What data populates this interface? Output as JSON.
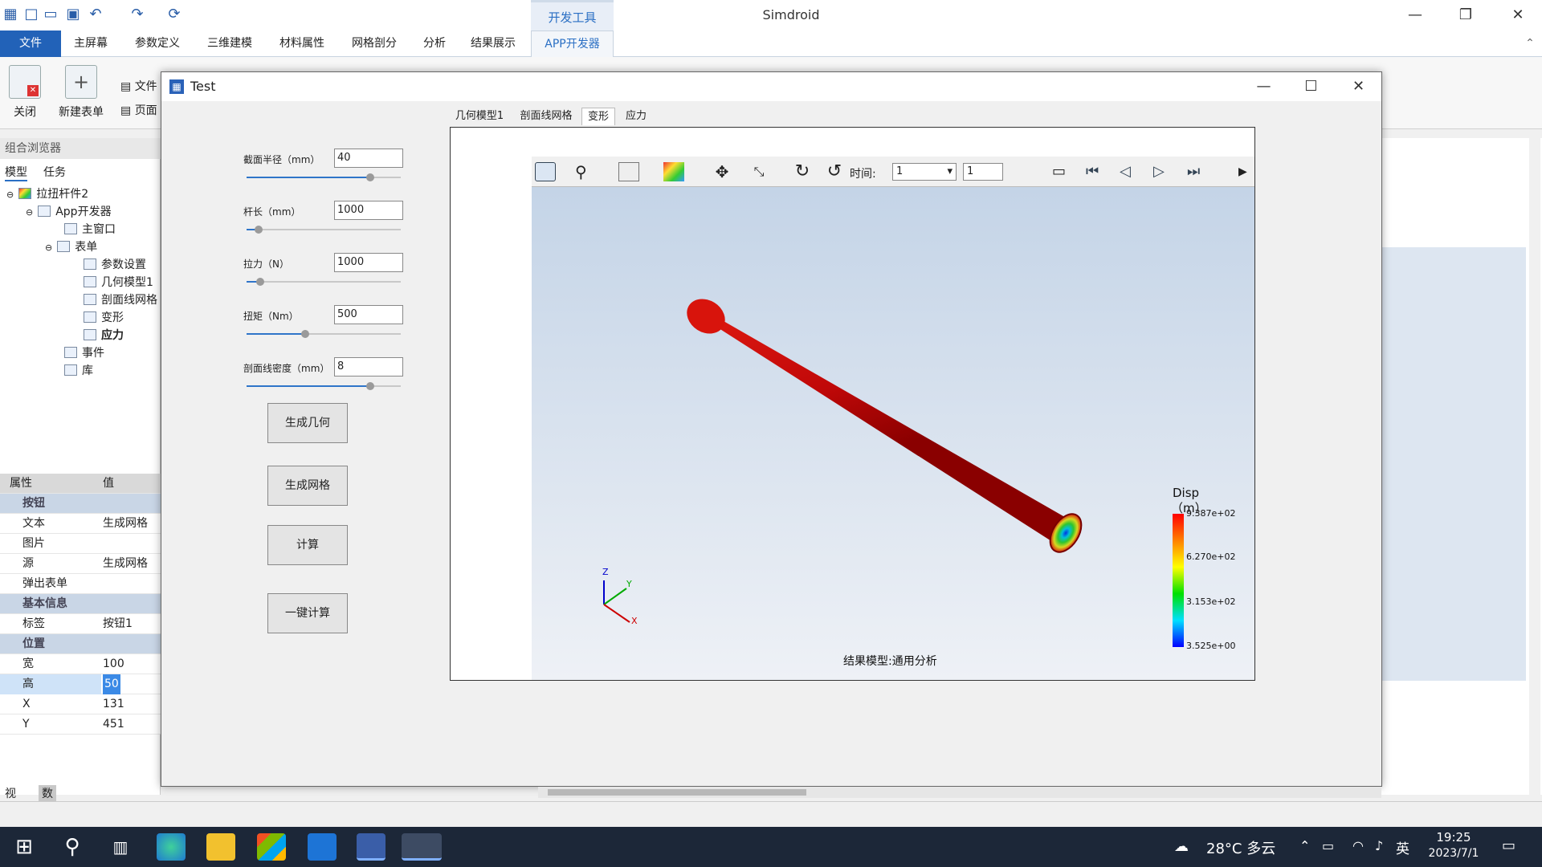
{
  "app_title": "Simdroid",
  "dev_group": "开发工具",
  "ribbon_tabs": [
    "文件",
    "主屏幕",
    "参数定义",
    "三维建模",
    "材料属性",
    "网格剖分",
    "分析",
    "结果展示",
    "APP开发器"
  ],
  "ribbon_buttons": {
    "close": "关闭",
    "new_form": "新建表单",
    "file_trunc": "文件",
    "page_trunc": "页面"
  },
  "left_panel": {
    "title": "组合浏览器",
    "tabs": [
      "模型",
      "任务"
    ],
    "tree": [
      {
        "label": "拉扭杆件2"
      },
      {
        "label": "App开发器"
      },
      {
        "label": "主窗口"
      },
      {
        "label": "表单"
      },
      {
        "label": "参数设置"
      },
      {
        "label": "几何模型1"
      },
      {
        "label": "剖面线网格"
      },
      {
        "label": "变形"
      },
      {
        "label": "应力"
      },
      {
        "label": "事件"
      },
      {
        "label": "库"
      }
    ]
  },
  "properties": {
    "header_key": "属性",
    "header_val": "值",
    "rows": [
      {
        "cat": "按钮"
      },
      {
        "k": "文本",
        "v": "生成网格"
      },
      {
        "k": "图片",
        "v": ""
      },
      {
        "k": "源",
        "v": "生成网格"
      },
      {
        "k": "弹出表单",
        "v": ""
      },
      {
        "cat": "基本信息"
      },
      {
        "k": "标签",
        "v": "按钮1"
      },
      {
        "cat": "位置"
      },
      {
        "k": "宽",
        "v": "100"
      },
      {
        "k": "高",
        "v": "50"
      },
      {
        "k": "X",
        "v": "131"
      },
      {
        "k": "Y",
        "v": "451"
      }
    ]
  },
  "bottom_tabs": [
    "视图",
    "数据"
  ],
  "dialog": {
    "title": "Test",
    "params": [
      {
        "label": "截面半径（mm）",
        "value": "40",
        "level": 0.8
      },
      {
        "label": "杆长（mm）",
        "value": "1000",
        "level": 0.08
      },
      {
        "label": "拉力（N）",
        "value": "1000",
        "level": 0.09
      },
      {
        "label": "扭矩（Nm）",
        "value": "500",
        "level": 0.38
      },
      {
        "label": "剖面线密度（mm）",
        "value": "8",
        "level": 0.8
      }
    ],
    "buttons": [
      "生成几何",
      "生成网格",
      "计算",
      "一键计算"
    ],
    "viewer_tabs": [
      "几何模型1",
      "剖面线网格",
      "变形",
      "应力"
    ],
    "time_label": "时间:",
    "time_value": "1",
    "step_value": "1",
    "legend": {
      "title": "Disp",
      "unit": "（m）",
      "ticks": [
        "9.387e+02",
        "6.270e+02",
        "3.153e+02",
        "3.525e+00"
      ]
    },
    "result_model": "结果模型:通用分析",
    "axes": {
      "z": "Z",
      "y": "Y",
      "x": "X"
    }
  },
  "taskbar": {
    "weather": "28°C 多云",
    "lang": "英",
    "time": "19:25",
    "date": "2023/7/1"
  }
}
